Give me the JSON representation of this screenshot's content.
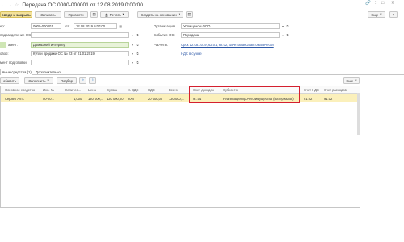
{
  "window": {
    "title": "Передача ОС 0000-000001 от 12.08.2019 0:00:00"
  },
  "toolbar": {
    "post_close": "оведи и закрыть",
    "write": "Записать",
    "post": "Провести",
    "print": "Печать",
    "create_based": "Создать на основании",
    "more": "Еще",
    "help": "?"
  },
  "form": {
    "number_label": "ер:",
    "number_value": "0000-000001",
    "date_from_label": "от:",
    "date_value": "12.08.2019 0:00:00",
    "org_label": "Организация:",
    "org_value": "Услищеном ООО",
    "location_label": "подразделение ОС:",
    "event_label": "Событие ОС:",
    "event_value": "Передача",
    "counterparty_label": "агент:",
    "counterparty_value": "Домашний интерьер",
    "calc_label": "Расчеты:",
    "calc_link": "Срок 12.08.2019, 62.01, 62.02, зачет аванса автоматически",
    "contract_label": "овор:",
    "contract_value": "Купли продажи ОС № 23 от 01.01.2019",
    "vat_link": "НДС в сумме",
    "prep_label": "мент подготовки:"
  },
  "tabs": [
    {
      "label": "вные средства (1)"
    },
    {
      "label": "Дополнительно"
    }
  ],
  "table_toolbar": {
    "add": "обавить",
    "fill": "Заполнить",
    "pick": "Подбор",
    "more": "Еще"
  },
  "table": {
    "headers": [
      "Основное средство",
      "Инв. №",
      "Количес...",
      "Цена",
      "Сумма",
      "% НДС",
      "НДС",
      "Всего",
      "Счет доходов",
      "Субконто",
      "Счет НДС",
      "Счет расходов"
    ],
    "row": [
      "Сервер AVI1",
      "00-00...",
      "1,000",
      "120 000,...",
      "120 000,00",
      "20%",
      "20 000,00",
      "120 000,...",
      "91.01",
      "Реализация прочего имущества (материалов)",
      "91.02",
      "91.02"
    ]
  }
}
